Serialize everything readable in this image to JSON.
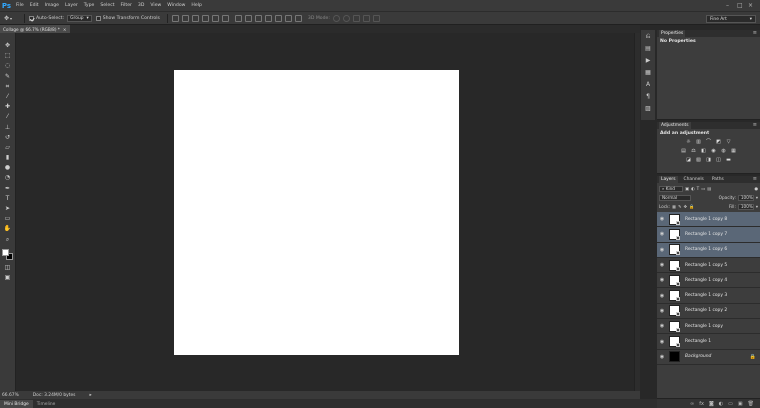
{
  "app": {
    "logo": "Ps"
  },
  "menu": [
    "File",
    "Edit",
    "Image",
    "Layer",
    "Type",
    "Select",
    "Filter",
    "3D",
    "View",
    "Window",
    "Help"
  ],
  "options": {
    "auto_select_label": "Auto-Select:",
    "auto_select_checked": true,
    "auto_select_mode": "Group",
    "show_transform_label": "Show Transform Controls",
    "mode_3d_label": "3D Mode:",
    "workspace": "Fine Art"
  },
  "document": {
    "tab_title": "Collage @ 66.7% (RGB/8) *",
    "zoom": "66.67%",
    "doc_info": "Doc: 3.24M/0 bytes"
  },
  "properties": {
    "tab": "Properties",
    "empty_text": "No Properties"
  },
  "adjustments": {
    "tab": "Adjustments",
    "heading": "Add an adjustment"
  },
  "layers_panel": {
    "tabs": [
      "Layers",
      "Channels",
      "Paths"
    ],
    "filter_kind": "Kind",
    "blend_mode": "Normal",
    "opacity_label": "Opacity:",
    "opacity_value": "100%",
    "lock_label": "Lock:",
    "fill_label": "Fill:",
    "fill_value": "100%",
    "layers": [
      {
        "name": "Rectangle 1 copy 8",
        "selected": true
      },
      {
        "name": "Rectangle 1 copy 7",
        "selected": true
      },
      {
        "name": "Rectangle 1 copy 6",
        "selected": true
      },
      {
        "name": "Rectangle 1 copy 5",
        "selected": false
      },
      {
        "name": "Rectangle 1 copy 4",
        "selected": false
      },
      {
        "name": "Rectangle 1 copy 3",
        "selected": false
      },
      {
        "name": "Rectangle 1 copy 2",
        "selected": false
      },
      {
        "name": "Rectangle 1 copy",
        "selected": false
      },
      {
        "name": "Rectangle 1",
        "selected": false
      },
      {
        "name": "Background",
        "selected": false,
        "background": true
      }
    ]
  },
  "bottom_tabs": [
    "Mini Bridge",
    "Timeline"
  ],
  "colors": {
    "canvas_bg": "#282828",
    "panel_bg": "#3d3d3d",
    "selection": "#5a6777",
    "ps_blue": "#31a8ff"
  }
}
